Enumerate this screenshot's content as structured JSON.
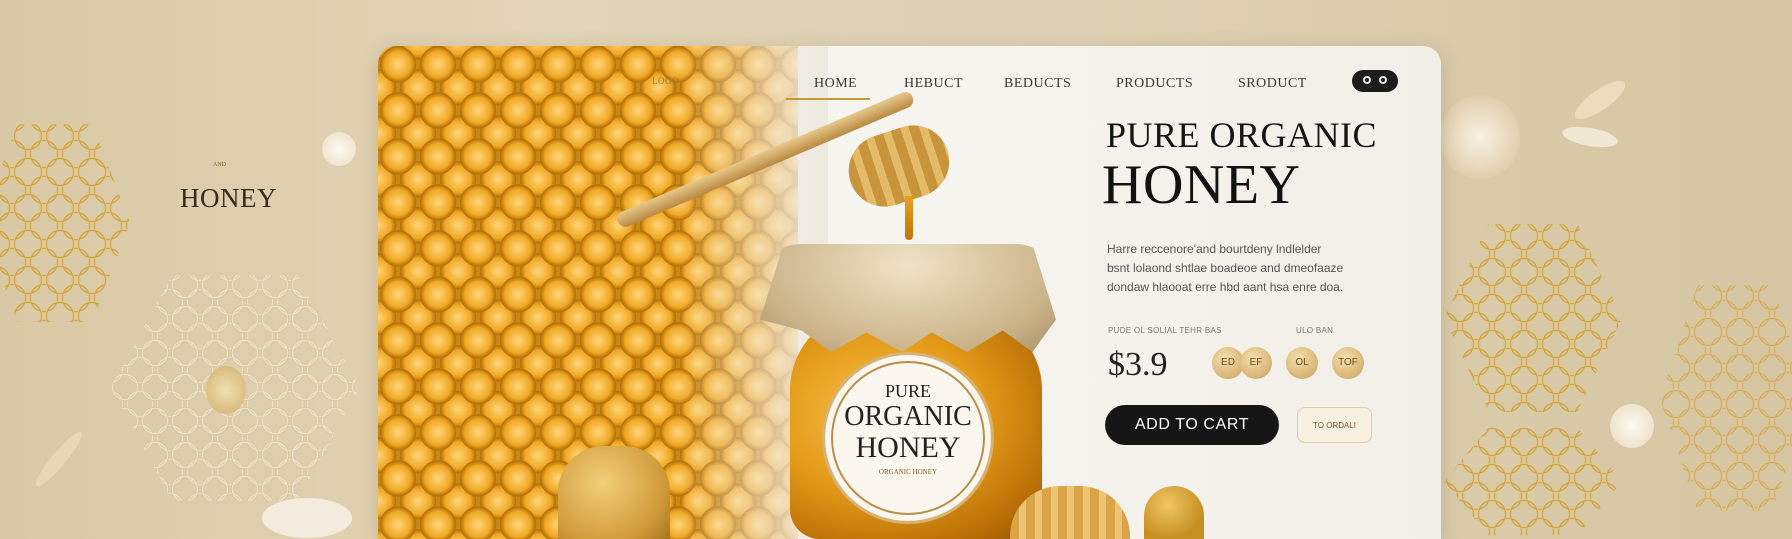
{
  "brand": {
    "small_label": "AND",
    "name": "HONEY"
  },
  "nav": {
    "items": [
      {
        "label": "LOGO"
      },
      {
        "label": "HOME"
      },
      {
        "label": "HEBUCT"
      },
      {
        "label": "BEDUCTS"
      },
      {
        "label": "PRODUCTS"
      },
      {
        "label": "SRODUCT"
      }
    ],
    "active_index": 1,
    "toggle_label": "O O"
  },
  "hero": {
    "title_line1": "PURE ORGANIC",
    "title_line2": "HONEY",
    "description": [
      "Harre reccenore'and bourtdeny lndlelder",
      "bsnt lolaond shtlae boadeoe and dmeofaaze",
      "dondaw hlaooat erre hbd aant hsa enre doa."
    ]
  },
  "pricing": {
    "headers": [
      "PUDE OL SOLIAL TEHR BAS",
      "ULO BAN"
    ],
    "price": "$3.9",
    "badges": [
      "ED",
      "EF",
      "OL",
      "TOF"
    ]
  },
  "actions": {
    "add_to_cart": "ADD TO CART",
    "secondary": "TO ORDALI"
  },
  "jar_label": {
    "line1": "PURE",
    "line2": "ORGANIC",
    "line3": "HONEY",
    "line4": "ORGANIC HONEY"
  },
  "colors": {
    "accent": "#c79a3e",
    "dark": "#161616",
    "honey": "#e39a18",
    "background": "#ddd0b2"
  }
}
